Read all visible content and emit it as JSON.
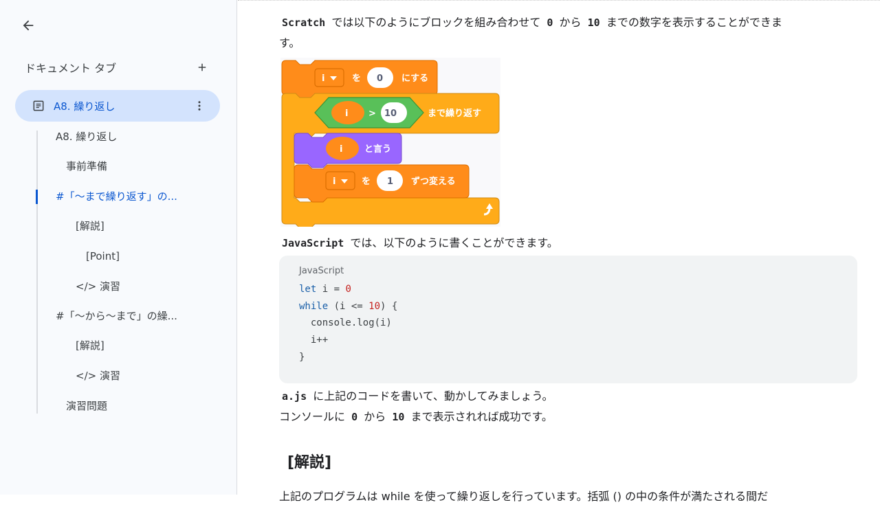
{
  "sidebar": {
    "tabs_title": "ドキュメント タブ",
    "active_tab": "A8. 繰り返し",
    "outline": [
      {
        "label": "A8. 繰り返し"
      },
      {
        "label": "事前準備"
      },
      {
        "label": "#「〜まで繰り返す」の..."
      },
      {
        "label": "[解説]"
      },
      {
        "label": "[Point]"
      },
      {
        "label": "</> 演習"
      },
      {
        "label": "#「〜から〜まで」の繰..."
      },
      {
        "label": "[解説]"
      },
      {
        "label": "</> 演習"
      },
      {
        "label": "演習問題"
      }
    ]
  },
  "main": {
    "para1": {
      "code1": "Scratch",
      "t1": "では以下のようにブロックを組み合わせて",
      "code2": "0",
      "t2": "から",
      "code3": "10",
      "t3": "までの数字を表示することができま",
      "line2": "す。"
    },
    "scratch": {
      "var": "i",
      "set_op": "を",
      "set_val": "0",
      "set_label": "にする",
      "cond_var": "i",
      "cond_op": ">",
      "cond_val": "10",
      "repeat_label": "まで繰り返す",
      "say_var": "i",
      "say_label": "と言う",
      "change_var": "i",
      "change_op": "を",
      "change_val": "1",
      "change_label": "ずつ変える"
    },
    "para2": {
      "code": "JavaScript",
      "text": "では、以下のように書くことができます。"
    },
    "code_block": {
      "lang": "JavaScript",
      "lines": [
        {
          "a": "let",
          "b": " i = ",
          "c": "0",
          "d": ""
        },
        {
          "a": "while",
          "b": " (i <= ",
          "c": "10",
          "d": ") {"
        },
        {
          "a": "",
          "b": "  console.log(i)",
          "c": "",
          "d": ""
        },
        {
          "a": "",
          "b": "  i++",
          "c": "",
          "d": ""
        },
        {
          "a": "",
          "b": "}",
          "c": "",
          "d": ""
        }
      ]
    },
    "para3": {
      "code": "a.js",
      "text": "に上記のコードを書いて、動かしてみましょう。"
    },
    "para4": {
      "t1": "コンソールに",
      "code1": "0",
      "t2": "から",
      "code2": "10",
      "t3": "まで表示されれば成功です。"
    },
    "heading": "[解説]",
    "para5": "上記のプログラムは while を使って繰り返しを行っています。括弧 () の中の条件が満たされる間だ"
  }
}
